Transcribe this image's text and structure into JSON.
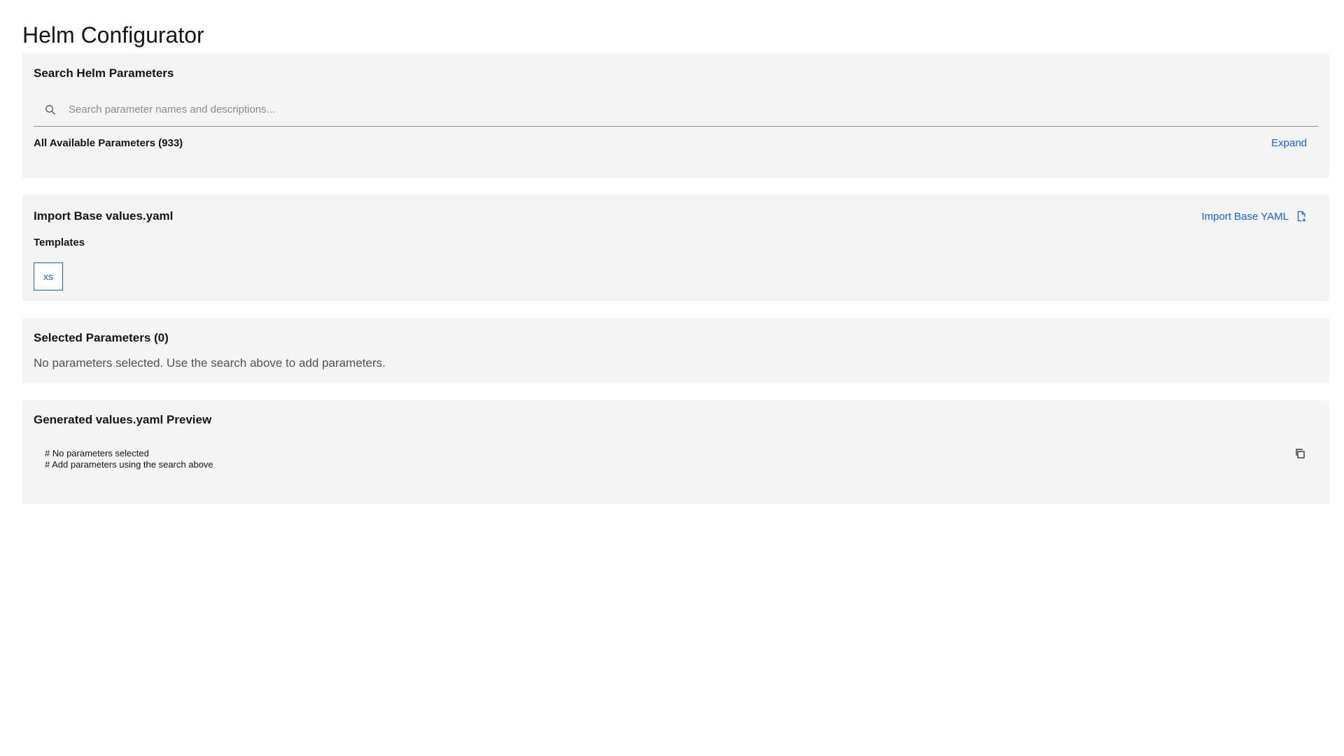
{
  "app": {
    "title": "Helm Configurator"
  },
  "search_section": {
    "title": "Search Helm Parameters",
    "search_icon": "search-icon",
    "placeholder": "Search parameter names and descriptions...",
    "value": "",
    "available_label": "All Available Parameters (933)",
    "expand_label": "Expand"
  },
  "import_section": {
    "title": "Import Base values.yaml",
    "import_button_label": "Import Base YAML",
    "import_icon": "document-import-icon",
    "templates_label": "Templates",
    "templates": [
      {
        "label": "xs"
      }
    ]
  },
  "selected_section": {
    "title": "Selected Parameters (0)",
    "empty_message": "No parameters selected. Use the search above to add parameters."
  },
  "preview_section": {
    "title": "Generated values.yaml Preview",
    "code_lines": [
      "# No parameters selected",
      "# Add parameters using the search above"
    ],
    "copy_icon": "copy-icon"
  },
  "colors": {
    "accent": "#0f62fe",
    "tile_background": "#f4f4f4",
    "text_primary": "#161616",
    "text_secondary": "#525252",
    "placeholder": "#8d8d8d"
  }
}
